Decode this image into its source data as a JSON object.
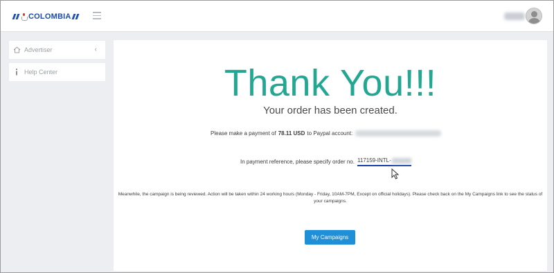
{
  "header": {
    "logo_text": "COLOMBIA",
    "menu_icon": "hamburger-icon",
    "avatar_icon": "user-avatar-icon"
  },
  "sidebar": {
    "items": [
      {
        "label": "Advertiser",
        "icon": "home-icon",
        "chevron": "‹"
      },
      {
        "label": "Help Center",
        "icon": "info-icon"
      }
    ]
  },
  "main": {
    "title": "Thank You!!!",
    "subtitle": "Your order has been created.",
    "payment_prefix": "Please make a payment of",
    "payment_amount": "78.11 USD",
    "payment_suffix": "to Paypal account:",
    "reference_prefix": "In payment reference, please specify order no.",
    "order_number": "117159-INTL-",
    "notice": "Meanwhile, the campaign is being reviewed. Action will be taken within 24 working hours (Monday - Friday, 10AM-7PM, Except on official holidays). Please check back on the My Campaigns link to see the status of your campaigns.",
    "button_label": "My Campaigns"
  },
  "colors": {
    "accent_teal": "#23a792",
    "button_blue": "#1f8fd8",
    "logo_blue": "#1d4aa9"
  }
}
